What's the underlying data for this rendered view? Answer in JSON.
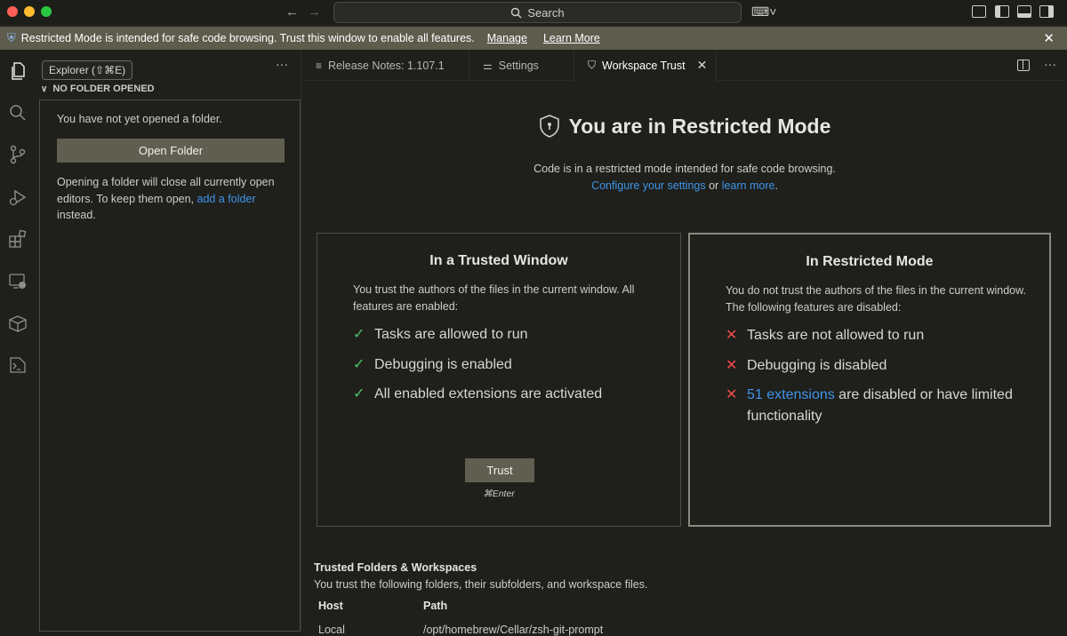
{
  "titlebar": {
    "search_label": "Search",
    "icons": [
      "back-arrow-icon",
      "forward-arrow-icon",
      "search-icon",
      "copilot-icon",
      "layout-icon",
      "toggle-sidebar-icon",
      "toggle-panel-icon",
      "toggle-secondary-sidebar-icon"
    ]
  },
  "banner": {
    "message": "Restricted Mode is intended for safe code browsing. Trust this window to enable all features.",
    "manage_label": "Manage",
    "learn_more_label": "Learn More",
    "background": "#5d5c4d"
  },
  "activitybar": {
    "tooltip": "Explorer (⇧⌘E)",
    "items": [
      "explorer-icon",
      "search-icon",
      "source-control-icon",
      "run-debug-icon",
      "extensions-icon",
      "remote-explorer-icon",
      "containers-icon",
      "terminal-icon"
    ]
  },
  "sidebar": {
    "more_label": "···",
    "section_title": "NO FOLDER OPENED",
    "not_opened_text": "You have not yet opened a folder.",
    "open_folder_label": "Open Folder",
    "note_prefix": "Opening a folder will close all currently open editors. To keep them open, ",
    "note_link": "add a folder",
    "note_suffix": " instead."
  },
  "tabs": [
    {
      "label": "Release Notes: 1.107.1",
      "icon": "release-notes-icon"
    },
    {
      "label": "Settings",
      "icon": "settings-icon"
    },
    {
      "label": "Workspace Trust",
      "icon": "shield-icon",
      "active": true
    }
  ],
  "editor": {
    "title": "You are in Restricted Mode",
    "subtitle": "Code is in a restricted mode intended for safe code browsing.",
    "configure_link": "Configure your settings",
    "or_text": " or ",
    "learn_more_link": "learn more",
    "period": ".",
    "trusted_card": {
      "title": "In a Trusted Window",
      "description": "You trust the authors of the files in the current window. All features are enabled:",
      "features": [
        "Tasks are allowed to run",
        "Debugging is enabled",
        "All enabled extensions are activated"
      ],
      "button_label": "Trust",
      "shortcut": "⌘Enter"
    },
    "restricted_card": {
      "title": "In Restricted Mode",
      "description": "You do not trust the authors of the files in the current window. The following features are disabled:",
      "features": [
        "Tasks are not allowed to run",
        "Debugging is disabled"
      ],
      "extensions_link": "51 extensions",
      "extensions_suffix": " are disabled or have limited functionality"
    },
    "trusted_folders": {
      "title": "Trusted Folders & Workspaces",
      "description": "You trust the following folders, their subfolders, and workspace files.",
      "columns": [
        "Host",
        "Path"
      ],
      "rows": [
        [
          "Local",
          "/opt/homebrew/Cellar/zsh-git-prompt"
        ]
      ]
    }
  },
  "colors": {
    "accent_link": "#3f95e9",
    "check": "#4ec46a",
    "cross": "#f14c4c",
    "button": "#5f5e50"
  }
}
